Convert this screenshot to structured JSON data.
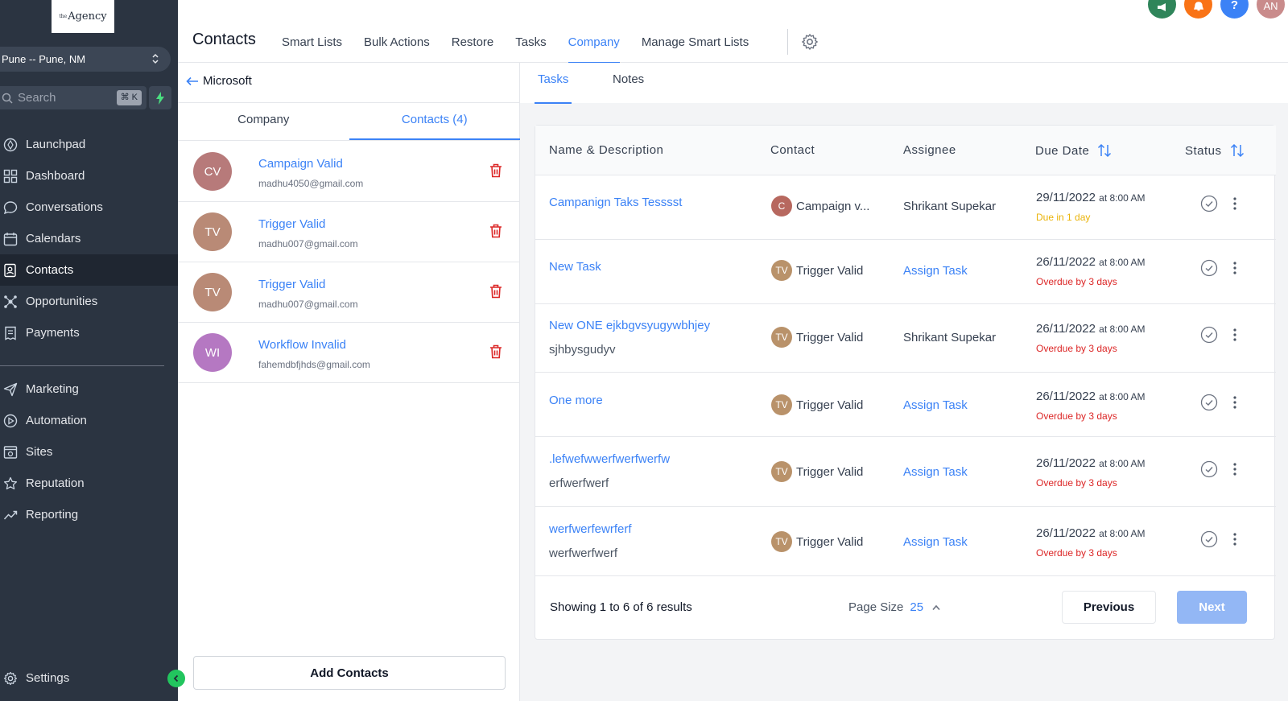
{
  "sidebar": {
    "logo": {
      "sup": "the",
      "text": "Agency"
    },
    "location": "Pune -- Pune, NM",
    "search": {
      "placeholder": "Search",
      "shortcut": "⌘ K"
    },
    "items": [
      {
        "label": "Launchpad",
        "icon": "rocket-icon"
      },
      {
        "label": "Dashboard",
        "icon": "grid-icon"
      },
      {
        "label": "Conversations",
        "icon": "chat-icon"
      },
      {
        "label": "Calendars",
        "icon": "calendar-icon"
      },
      {
        "label": "Contacts",
        "icon": "contacts-icon",
        "active": true
      },
      {
        "label": "Opportunities",
        "icon": "network-icon"
      },
      {
        "label": "Payments",
        "icon": "receipt-icon"
      }
    ],
    "items2": [
      {
        "label": "Marketing",
        "icon": "send-icon"
      },
      {
        "label": "Automation",
        "icon": "automation-icon"
      },
      {
        "label": "Sites",
        "icon": "sites-icon"
      },
      {
        "label": "Reputation",
        "icon": "star-icon"
      },
      {
        "label": "Reporting",
        "icon": "chart-line-icon"
      }
    ],
    "settings": "Settings"
  },
  "topbar": {
    "title": "Contacts",
    "tabs": [
      "Smart Lists",
      "Bulk Actions",
      "Restore",
      "Tasks",
      "Company",
      "Manage Smart Lists"
    ],
    "active_tab": "Company",
    "avatar_initials": "AN",
    "colors": {
      "megaphone": "#2f855a",
      "bell": "#f97316",
      "help": "#3b82f6",
      "avatar": "#c98b8b"
    }
  },
  "company_panel": {
    "back_label": "Microsoft",
    "tabs": [
      "Company",
      "Contacts (4)"
    ],
    "contacts": [
      {
        "initials": "CV",
        "name": "Campaign Valid",
        "email": "madhu4050@gmail.com",
        "color": "#b77a7a"
      },
      {
        "initials": "TV",
        "name": "Trigger Valid",
        "email": "madhu007@gmail.com",
        "color": "#b98a76"
      },
      {
        "initials": "TV",
        "name": "Trigger Valid",
        "email": "madhu007@gmail.com",
        "color": "#b98a76"
      },
      {
        "initials": "WI",
        "name": "Workflow Invalid",
        "email": "fahemdbfjhds@gmail.com",
        "color": "#b578c2"
      }
    ],
    "add_button": "Add Contacts"
  },
  "tasks_panel": {
    "tabs": [
      "Tasks",
      "Notes"
    ],
    "columns": [
      "Name & Description",
      "Contact",
      "Assignee",
      "Due Date",
      "Status"
    ],
    "rows": [
      {
        "name": "Campanign Taks Tesssst",
        "description": "",
        "contact_initial": "C",
        "contact_name": "Campaign v...",
        "contact_color": "#b7685f",
        "assignee": "Shrikant Supekar",
        "assignee_link": false,
        "date": "29/11/2022",
        "time": "at 8:00 AM",
        "due_text": "Due in 1 day",
        "due_color": "#eab308"
      },
      {
        "name": "New Task",
        "description": "",
        "contact_initial": "TV",
        "contact_name": "Trigger Valid",
        "contact_color": "#b9926a",
        "assignee": "Assign Task",
        "assignee_link": true,
        "date": "26/11/2022",
        "time": "at 8:00 AM",
        "due_text": "Overdue by 3 days",
        "due_color": "#dc2626"
      },
      {
        "name": "New ONE ejkbgvsyugywbhjey",
        "description": "sjhbysgudyv",
        "contact_initial": "TV",
        "contact_name": "Trigger Valid",
        "contact_color": "#b9926a",
        "assignee": "Shrikant Supekar",
        "assignee_link": false,
        "date": "26/11/2022",
        "time": "at 8:00 AM",
        "due_text": "Overdue by 3 days",
        "due_color": "#dc2626"
      },
      {
        "name": "One more",
        "description": "",
        "contact_initial": "TV",
        "contact_name": "Trigger Valid",
        "contact_color": "#b9926a",
        "assignee": "Assign Task",
        "assignee_link": true,
        "date": "26/11/2022",
        "time": "at 8:00 AM",
        "due_text": "Overdue by 3 days",
        "due_color": "#dc2626"
      },
      {
        "name": ".lefwefwwerfwerfwerfw",
        "description": "erfwerfwerf",
        "contact_initial": "TV",
        "contact_name": "Trigger Valid",
        "contact_color": "#b9926a",
        "assignee": "Assign Task",
        "assignee_link": true,
        "date": "26/11/2022",
        "time": "at 8:00 AM",
        "due_text": "Overdue by 3 days",
        "due_color": "#dc2626"
      },
      {
        "name": "werfwerfewrferf",
        "description": "werfwerfwerf",
        "contact_initial": "TV",
        "contact_name": "Trigger Valid",
        "contact_color": "#b9926a",
        "assignee": "Assign Task",
        "assignee_link": true,
        "date": "26/11/2022",
        "time": "at 8:00 AM",
        "due_text": "Overdue by 3 days",
        "due_color": "#dc2626"
      }
    ],
    "footer": {
      "showing": "Showing 1 to 6 of 6 results",
      "page_size_label": "Page Size",
      "page_size": "25",
      "previous": "Previous",
      "next": "Next"
    }
  }
}
